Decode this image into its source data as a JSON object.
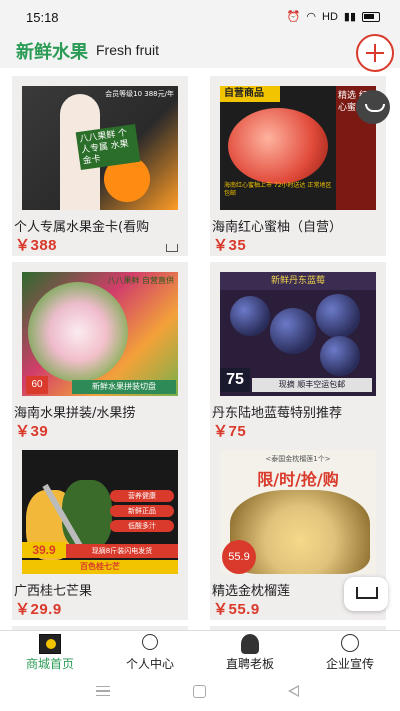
{
  "status_bar": {
    "time": "15:18",
    "network": "HD"
  },
  "header": {
    "title_cn": "新鲜水果",
    "title_en": "Fresh fruit",
    "add_icon": "plus-circle-icon"
  },
  "products": [
    {
      "name": "个人专属水果金卡(看购",
      "price": "￥388",
      "thumb": {
        "corner": "会员等级10 388元/年",
        "card": "八八果鲜 个人专属 水果金卡"
      }
    },
    {
      "name": "海南红心蜜柚（自营）",
      "price": "￥35",
      "thumb": {
        "banner": "自营商品",
        "side": "精选 红心蜜柚",
        "bottom": "海南红心蜜柚上市 72小时送达 正常地区包邮"
      }
    },
    {
      "name": "海南水果拼装/水果捞",
      "price": "￥39",
      "thumb": {
        "top_right": "八八果鲜 自营直供",
        "bar": "新鲜水果拼装切盘",
        "badge": "60"
      }
    },
    {
      "name": "丹东陆地蓝莓特别推荐",
      "price": "￥75",
      "thumb": {
        "top": "新鲜丹东蓝莓",
        "tag": "75",
        "promo": "现摘 顺丰空运包邮"
      }
    },
    {
      "name": "广西桂七芒果",
      "price": "￥29.9",
      "thumb": {
        "tags": [
          "营养健康",
          "新鲜正品",
          "低酸多汁"
        ],
        "price": "39.9",
        "red_bar": "现摘8斤装闪电发货",
        "bottom": "百色桂七芒"
      }
    },
    {
      "name": "精选金枕榴莲",
      "price": "￥55.9",
      "thumb": {
        "head": "<泰国金枕榴莲1个>",
        "title": "限/时/抢/购",
        "circle": "55.9"
      }
    }
  ],
  "nav": {
    "items": [
      {
        "label": "商城首页",
        "icon": "store-home-icon"
      },
      {
        "label": "个人中心",
        "icon": "person-icon"
      },
      {
        "label": "直聘老板",
        "icon": "boss-icon"
      },
      {
        "label": "企业宣传",
        "icon": "company-icon"
      }
    ]
  },
  "colors": {
    "accent_green": "#2b9b56",
    "price_red": "#d93a2b"
  }
}
